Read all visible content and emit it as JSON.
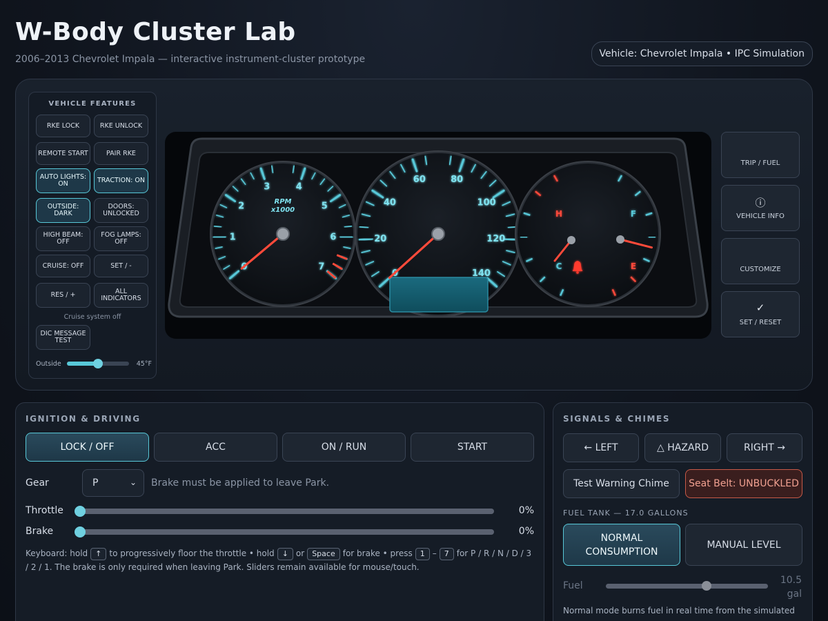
{
  "header": {
    "title": "W-Body Cluster Lab",
    "subtitle": "2006–2013 Chevrolet Impala — interactive instrument-cluster prototype",
    "vehicle_pill": "Vehicle: Chevrolet Impala • IPC Simulation"
  },
  "features": {
    "title": "VEHICLE FEATURES",
    "buttons": [
      {
        "label": "RKE LOCK",
        "active": false
      },
      {
        "label": "RKE UNLOCK",
        "active": false
      },
      {
        "label": "REMOTE START",
        "active": false
      },
      {
        "label": "PAIR RKE",
        "active": false
      },
      {
        "label": "AUTO LIGHTS: ON",
        "active": true
      },
      {
        "label": "TRACTION: ON",
        "active": true
      },
      {
        "label": "OUTSIDE: DARK",
        "active": true
      },
      {
        "label": "DOORS: UNLOCKED",
        "active": false
      },
      {
        "label": "HIGH BEAM: OFF",
        "active": false
      },
      {
        "label": "FOG LAMPS: OFF",
        "active": false
      },
      {
        "label": "CRUISE: OFF",
        "active": false
      },
      {
        "label": "SET / -",
        "active": false
      },
      {
        "label": "RES / +",
        "active": false
      },
      {
        "label": "ALL INDICATORS",
        "active": false
      }
    ],
    "cruise_status": "Cruise system off",
    "dic_button": "DIC MESSAGE TEST",
    "outside_label": "Outside",
    "outside_temp": "45°F",
    "outside_level": 0.5
  },
  "cluster": {
    "tach": {
      "ticks": [
        "0",
        "1",
        "2",
        "3",
        "4",
        "5",
        "6",
        "7"
      ],
      "unit_line1": "RPM",
      "unit_line2": "x1000",
      "value": 0
    },
    "speedo": {
      "ticks": [
        "0",
        "20",
        "40",
        "60",
        "80",
        "100",
        "120",
        "140"
      ],
      "value": 0
    },
    "temp": {
      "hot": "H",
      "cold": "C"
    },
    "fuel": {
      "full": "F",
      "empty": "E",
      "level": 0.62
    },
    "colors": {
      "accent": "#58c8d8",
      "needle": "#ff4a3a",
      "warning": "#ff3b2f"
    }
  },
  "side_buttons": [
    {
      "label": "TRIP / FUEL",
      "icon": "",
      "icon_name": "none"
    },
    {
      "label": "VEHICLE INFO",
      "icon": "ⓘ",
      "icon_name": "info-icon"
    },
    {
      "label": "CUSTOMIZE",
      "icon": "",
      "icon_name": "none"
    },
    {
      "label": "SET / RESET",
      "icon": "✓",
      "icon_name": "check-icon"
    }
  ],
  "ignition": {
    "title": "IGNITION & DRIVING",
    "modes": [
      {
        "label": "LOCK / OFF",
        "active": true
      },
      {
        "label": "ACC",
        "active": false
      },
      {
        "label": "ON / RUN",
        "active": false
      },
      {
        "label": "START",
        "active": false
      }
    ],
    "gear_label": "Gear",
    "gear_value": "P",
    "gear_hint": "Brake must be applied to leave Park.",
    "throttle_label": "Throttle",
    "throttle_value": "0%",
    "brake_label": "Brake",
    "brake_value": "0%",
    "help": {
      "t1": "Keyboard: hold",
      "k_up": "↑",
      "t2": "to progressively floor the throttle • hold",
      "k_down": "↓",
      "t3": "or",
      "k_space": "Space",
      "t4": "for brake • press",
      "k_1": "1",
      "t5": "–",
      "k_7": "7",
      "t6": "for P / R / N / D / 3 / 2 / 1. The brake is only required when leaving Park. Sliders remain available for mouse/touch."
    }
  },
  "signals": {
    "title": "SIGNALS & CHIMES",
    "left": "← LEFT",
    "hazard": "△ HAZARD",
    "right": "RIGHT →",
    "chime": "Test Warning Chime",
    "seatbelt": "Seat Belt: UNBUCKLED",
    "fuel_tank_label": "FUEL TANK — 17.0 GALLONS",
    "normal_mode": "NORMAL CONSUMPTION",
    "manual_mode": "MANUAL LEVEL",
    "fuel_label": "Fuel",
    "fuel_value": "10.5 gal",
    "fuel_note": "Normal mode burns fuel in real time from the simulated"
  }
}
